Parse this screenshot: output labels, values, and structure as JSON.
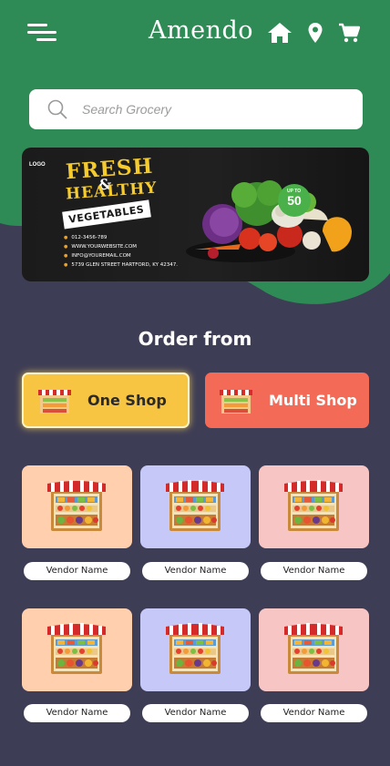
{
  "header": {
    "brand": "Amendo",
    "icons": [
      "menu-icon",
      "home-icon",
      "location-pin-icon",
      "cart-icon"
    ]
  },
  "search": {
    "placeholder": "Search Grocery"
  },
  "banner": {
    "logo": "LOGO",
    "line1": "FRESH",
    "ampersand": "&",
    "line2": "HEALTHY",
    "line3": "VEGETABLES",
    "discount": "50",
    "discount_prefix": "UP TO",
    "contacts": [
      "012-3456-789",
      "WWW.YOURWEBSITE.COM",
      "INFO@YOUREMAIL.COM",
      "5739 GLEN STREET HARTFORD, KY 42347."
    ]
  },
  "order": {
    "title": "Order from",
    "one_shop": "One Shop",
    "multi_shop": "Multi Shop"
  },
  "vendors": [
    {
      "name": "Vendor Name",
      "tint": "#ffcfae"
    },
    {
      "name": "Vendor Name",
      "tint": "#c6c8f8"
    },
    {
      "name": "Vendor Name",
      "tint": "#f7c5c3"
    },
    {
      "name": "Vendor Name",
      "tint": "#ffcfae"
    },
    {
      "name": "Vendor Name",
      "tint": "#c6c8f8"
    },
    {
      "name": "Vendor Name",
      "tint": "#f7c5c3"
    }
  ],
  "colors": {
    "green": "#2f8b55",
    "background": "#3e3d56",
    "one_shop": "#f7c542",
    "multi_shop": "#f36b57"
  }
}
